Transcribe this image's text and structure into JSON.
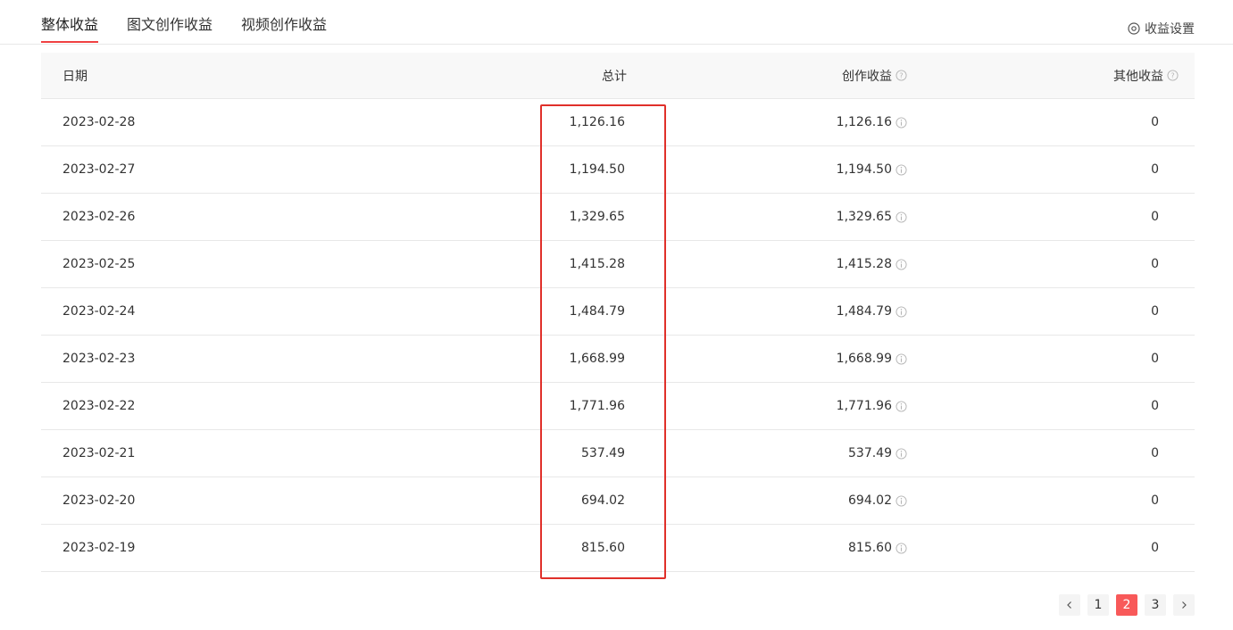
{
  "tabs": [
    {
      "label": "整体收益",
      "active": true
    },
    {
      "label": "图文创作收益",
      "active": false
    },
    {
      "label": "视频创作收益",
      "active": false
    }
  ],
  "settings_label": "收益设置",
  "table": {
    "headers": {
      "date": "日期",
      "total": "总计",
      "creation": "创作收益",
      "other": "其他收益"
    },
    "rows": [
      {
        "date": "2023-02-28",
        "total": "1,126.16",
        "creation": "1,126.16",
        "other": "0"
      },
      {
        "date": "2023-02-27",
        "total": "1,194.50",
        "creation": "1,194.50",
        "other": "0"
      },
      {
        "date": "2023-02-26",
        "total": "1,329.65",
        "creation": "1,329.65",
        "other": "0"
      },
      {
        "date": "2023-02-25",
        "total": "1,415.28",
        "creation": "1,415.28",
        "other": "0"
      },
      {
        "date": "2023-02-24",
        "total": "1,484.79",
        "creation": "1,484.79",
        "other": "0"
      },
      {
        "date": "2023-02-23",
        "total": "1,668.99",
        "creation": "1,668.99",
        "other": "0"
      },
      {
        "date": "2023-02-22",
        "total": "1,771.96",
        "creation": "1,771.96",
        "other": "0"
      },
      {
        "date": "2023-02-21",
        "total": "537.49",
        "creation": "537.49",
        "other": "0"
      },
      {
        "date": "2023-02-20",
        "total": "694.02",
        "creation": "694.02",
        "other": "0"
      },
      {
        "date": "2023-02-19",
        "total": "815.60",
        "creation": "815.60",
        "other": "0"
      }
    ]
  },
  "pagination": {
    "pages": [
      "1",
      "2",
      "3"
    ],
    "current": "2"
  },
  "colors": {
    "accent": "#f04142",
    "highlight_box": "#e0302a",
    "active_page": "#f85959"
  },
  "icons": {
    "settings": "settings-gear-icon",
    "header_help": "question-circle-icon",
    "cell_info": "info-circle-icon",
    "prev": "chevron-left-icon",
    "next": "chevron-right-icon"
  }
}
